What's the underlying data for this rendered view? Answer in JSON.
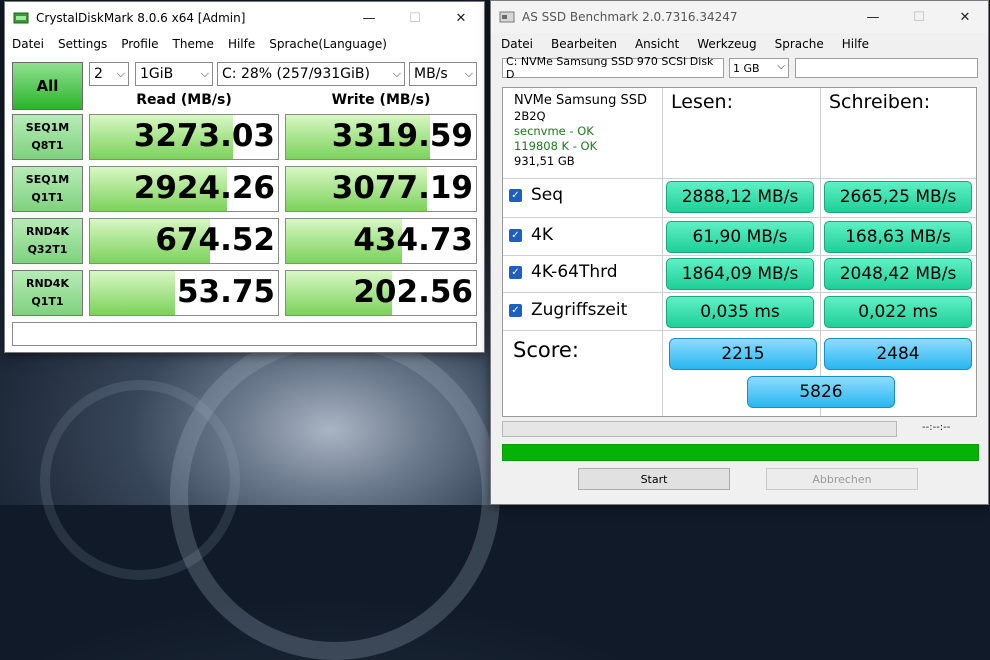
{
  "cdm": {
    "title": "CrystalDiskMark 8.0.6 x64 [Admin]",
    "menu": [
      "Datei",
      "Settings",
      "Profile",
      "Theme",
      "Hilfe",
      "Sprache(Language)"
    ],
    "all_label": "All",
    "count": "2",
    "size": "1GiB",
    "drive": "C: 28% (257/931GiB)",
    "unit": "MB/s",
    "read_header": "Read (MB/s)",
    "write_header": "Write (MB/s)",
    "rows": [
      {
        "l1": "SEQ1M",
        "l2": "Q8T1",
        "read": "3273.03",
        "write": "3319.59",
        "read_fill": 0.76,
        "write_fill": 0.76
      },
      {
        "l1": "SEQ1M",
        "l2": "Q1T1",
        "read": "2924.26",
        "write": "3077.19",
        "read_fill": 0.73,
        "write_fill": 0.74
      },
      {
        "l1": "RND4K",
        "l2": "Q32T1",
        "read": "674.52",
        "write": "434.73",
        "read_fill": 0.64,
        "write_fill": 0.61
      },
      {
        "l1": "RND4K",
        "l2": "Q1T1",
        "read": "53.75",
        "write": "202.56",
        "read_fill": 0.45,
        "write_fill": 0.56
      }
    ]
  },
  "asssd": {
    "title": "AS SSD Benchmark 2.0.7316.34247",
    "menu": [
      "Datei",
      "Bearbeiten",
      "Ansicht",
      "Werkzeug",
      "Sprache",
      "Hilfe"
    ],
    "drive": "C: NVMe Samsung SSD 970 SCSI Disk D",
    "size": "1 GB",
    "info": {
      "name": "NVMe Samsung SSD",
      "fw": "2B2Q",
      "driver": "secnvme - OK",
      "align": "119808 K - OK",
      "capacity": "931,51 GB"
    },
    "read_header": "Lesen:",
    "write_header": "Schreiben:",
    "rows": [
      {
        "label": "Seq",
        "read": "2888,12 MB/s",
        "write": "2665,25 MB/s"
      },
      {
        "label": "4K",
        "read": "61,90 MB/s",
        "write": "168,63 MB/s"
      },
      {
        "label": "4K-64Thrd",
        "read": "1864,09 MB/s",
        "write": "2048,42 MB/s"
      },
      {
        "label": "Zugriffszeit",
        "read": "0,035 ms",
        "write": "0,022 ms"
      }
    ],
    "check": "✓",
    "score_label": "Score:",
    "score_read": "2215",
    "score_write": "2484",
    "score_total": "5826",
    "time": "--:--:--",
    "start": "Start",
    "abort": "Abbrechen"
  }
}
